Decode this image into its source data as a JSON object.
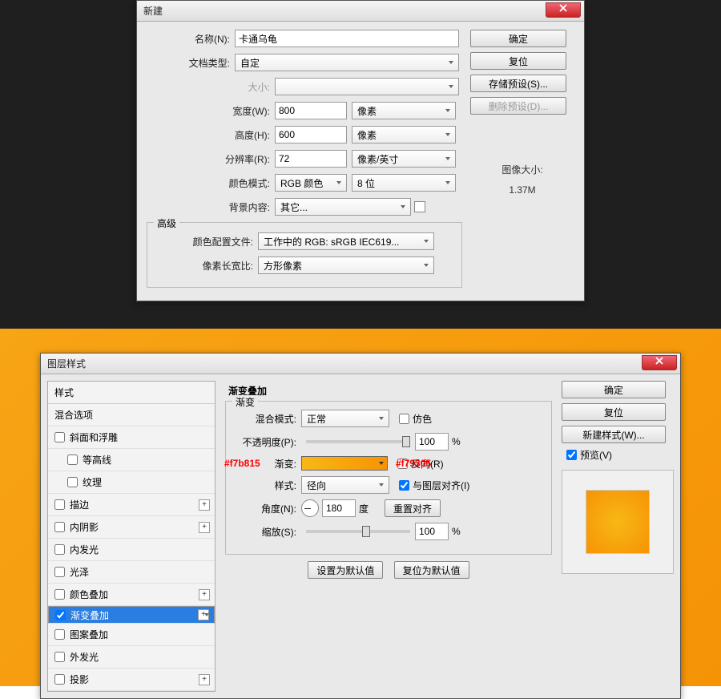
{
  "dialog1": {
    "title": "新建",
    "rows": {
      "name_label": "名称(N):",
      "name_value": "卡通乌龟",
      "doctype_label": "文档类型:",
      "doctype_value": "自定",
      "size_label": "大小:",
      "size_value": "",
      "width_label": "宽度(W):",
      "width_value": "800",
      "width_unit": "像素",
      "height_label": "高度(H):",
      "height_value": "600",
      "height_unit": "像素",
      "res_label": "分辨率(R):",
      "res_value": "72",
      "res_unit": "像素/英寸",
      "mode_label": "颜色模式:",
      "mode_value": "RGB 颜色",
      "mode_bits": "8 位",
      "bg_label": "背景内容:",
      "bg_value": "其它...",
      "advanced_label": "高级",
      "profile_label": "颜色配置文件:",
      "profile_value": "工作中的 RGB: sRGB IEC619...",
      "aspect_label": "像素长宽比:",
      "aspect_value": "方形像素"
    },
    "buttons": {
      "ok": "确定",
      "reset": "复位",
      "savepreset": "存储预设(S)...",
      "deletepreset": "删除预设(D)..."
    },
    "imagesize_label": "图像大小:",
    "imagesize_value": "1.37M"
  },
  "dialog2": {
    "title": "图层样式",
    "left": {
      "header": "样式",
      "blend": "混合选项",
      "bevel": "斜面和浮雕",
      "contour": "等高线",
      "texture": "纹理",
      "stroke": "描边",
      "innershadow": "内阴影",
      "innerglow": "内发光",
      "satin": "光泽",
      "coloroverlay": "颜色叠加",
      "gradientoverlay": "渐变叠加",
      "patternoverlay": "图案叠加",
      "outerglow": "外发光",
      "dropshadow": "投影",
      "plus": "+"
    },
    "mid": {
      "section": "渐变叠加",
      "subsection": "渐变",
      "blendmode_label": "混合模式:",
      "blendmode_value": "正常",
      "dither_label": "仿色",
      "opacity_label": "不透明度(P):",
      "opacity_value": "100",
      "percent": "%",
      "gradient_label": "渐变:",
      "reverse_label": "反向(R)",
      "style_label": "样式:",
      "style_value": "径向",
      "align_label": "与图层对齐(I)",
      "angle_label": "角度(N):",
      "angle_value": "180",
      "degree": "度",
      "resetalign": "重置对齐",
      "scale_label": "缩放(S):",
      "scale_value": "100",
      "setdefault": "设置为默认值",
      "resetdefault": "复位为默认值",
      "color1": "#f7b815",
      "color2": "#f79305"
    },
    "right": {
      "ok": "确定",
      "reset": "复位",
      "newstyle": "新建样式(W)...",
      "preview_label": "预览(V)"
    }
  }
}
